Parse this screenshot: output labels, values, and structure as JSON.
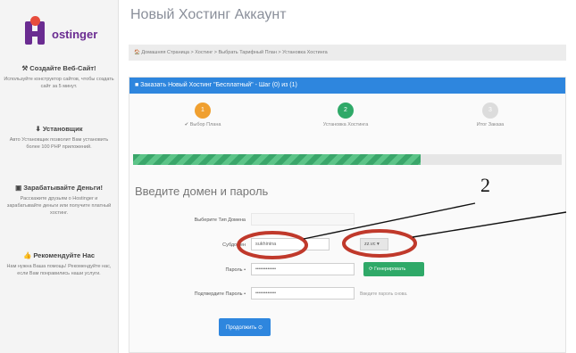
{
  "sidebar": {
    "logo_text": "ostinger",
    "blocks": [
      {
        "title": "⚒ Создайте Веб-Сайт!",
        "text": "Используйте конструктор сайтов, чтобы создать сайт за 5 минут."
      },
      {
        "title": "⬇ Установщик",
        "text": "Авто Установщик позволит Вам установить более 100 PHP приложений."
      },
      {
        "title": "▣ Зарабатывайте Деньги!",
        "text": "Расскажите друзьям о Hostinger и зарабатывайте деньги или получите платный хостинг."
      },
      {
        "title": "👍 Рекомендуйте Нас",
        "text": "Нам нужна Ваша помощь! Рекомендуйте нас, если Вам понравились наши услуги."
      }
    ]
  },
  "main": {
    "title": "Новый Хостинг Аккаунт",
    "breadcrumb": "🏠 Домашняя Страница  >  Хостинг  >  Выбрать Тарифный План  >  Установка Хостинга",
    "panel_title": "■ Заказать Новый Хостинг \"Бесплатный\" - Шаг (0) из (1)",
    "steps": [
      {
        "number": "1",
        "label": "✔ Выбор Плана",
        "color": "#f0a030"
      },
      {
        "number": "2",
        "label": "Установка Хостинга",
        "color": "#2fa968"
      },
      {
        "number": "3",
        "label": "Итог Заказа",
        "color": "#dcdcdc"
      }
    ],
    "progress": 0.67,
    "form_title": "Введите домен и пароль",
    "form": {
      "domain_type_label": "Выберите Тип Домена",
      "subdomain_label": "Субдомен",
      "subdomain_value": "sukhinina",
      "domain_select": "zz.vc ▾",
      "password_label": "Пароль •",
      "password_value": "••••••••••••",
      "generate_button": "⟳ Генерировать",
      "confirm_label": "Подтвердите Пароль •",
      "confirm_value": "••••••••••••",
      "confirm_hint": "Введите пароль снова.",
      "submit_button": "Продолжить ⊙"
    }
  },
  "annotations": {
    "label_1": "2",
    "ellipse_color": "#c0392b"
  }
}
